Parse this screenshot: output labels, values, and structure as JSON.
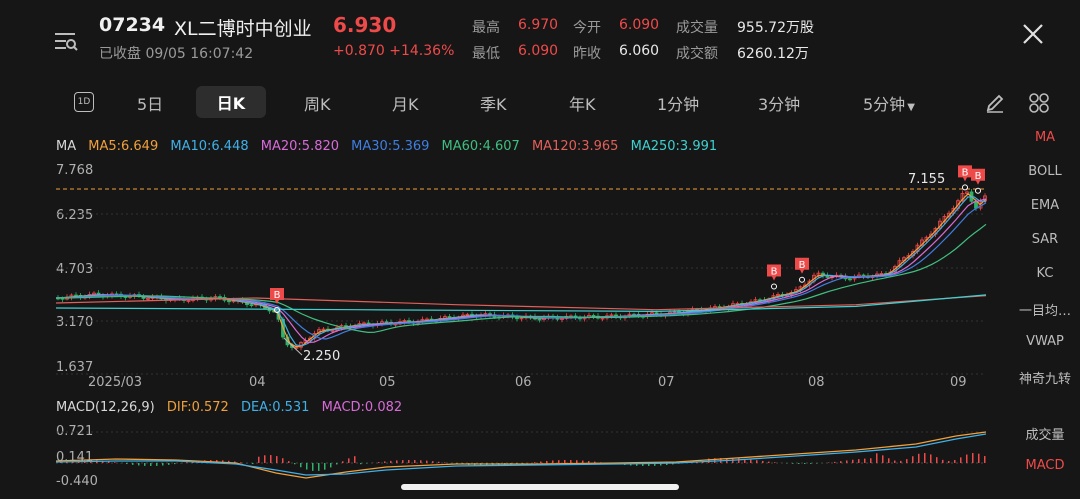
{
  "header": {
    "code": "07234",
    "name": "XL二博时中创业",
    "price": "6.930",
    "status": "已收盘 09/05 16:07:42",
    "change": "+0.870  +14.36%"
  },
  "quote": {
    "high_label": "最高",
    "high": "6.970",
    "open_label": "今开",
    "open": "6.090",
    "volume_label": "成交量",
    "volume": "955.72万股",
    "low_label": "最低",
    "low": "6.090",
    "prev_label": "昨收",
    "prev": "6.060",
    "amount_label": "成交额",
    "amount": "6260.12万"
  },
  "tabs": {
    "icon_1d": "1D",
    "t5d": "5日",
    "tday": "日K",
    "tweek": "周K",
    "tmonth": "月K",
    "tquarter": "季K",
    "tyear": "年K",
    "t1m": "1分钟",
    "t3m": "3分钟",
    "t5m": "5分钟"
  },
  "ma": {
    "title": "MA",
    "ma5": "MA5:6.649",
    "ma10": "MA10:6.448",
    "ma20": "MA20:5.820",
    "ma30": "MA30:5.369",
    "ma60": "MA60:4.607",
    "ma120": "MA120:3.965",
    "ma250": "MA250:3.991"
  },
  "colors": {
    "ma5": "#f0a03c",
    "ma10": "#3fb0e8",
    "ma20": "#d86bd8",
    "ma30": "#3f7fe0",
    "ma60": "#3fbf7f",
    "ma120": "#e0605a",
    "ma250": "#3fd0d0",
    "up": "#ef4a4a",
    "down": "#2fb36a",
    "accent": "#ef4a4a",
    "dif": "#f0a03c",
    "dea": "#3fb0e8",
    "macd": "#d86bd8"
  },
  "price_axis": [
    "7.768",
    "6.235",
    "4.703",
    "3.170",
    "1.637"
  ],
  "date_axis": [
    "2025/03",
    "04",
    "05",
    "06",
    "07",
    "08",
    "09"
  ],
  "annotations": {
    "high": "7.155",
    "low": "2.250",
    "buy_marker": "B"
  },
  "macd": {
    "title": "MACD(12,26,9)",
    "dif": "DIF:0.572",
    "dea": "DEA:0.531",
    "macd": "MACD:0.082",
    "axis": [
      "0.721",
      "0.141",
      "-0.440"
    ]
  },
  "sidebar": [
    "MA",
    "BOLL",
    "EMA",
    "SAR",
    "KC",
    "一目均…",
    "VWAP",
    "神奇九转",
    "成交量",
    "MACD"
  ],
  "chart_data": {
    "type": "candlestick",
    "series": [
      {
        "name": "MA5",
        "x": [
          "2025/03",
          "04",
          "05",
          "06",
          "07",
          "08",
          "09"
        ],
        "values": [
          3.9,
          3.2,
          3.3,
          3.5,
          3.6,
          4.6,
          6.65
        ]
      },
      {
        "name": "MA250",
        "x": [
          "2025/03",
          "04",
          "05",
          "06",
          "07",
          "08",
          "09"
        ],
        "values": [
          3.6,
          3.55,
          3.5,
          3.5,
          3.55,
          3.7,
          3.99
        ]
      }
    ],
    "ylim": [
      1.637,
      7.768
    ]
  }
}
